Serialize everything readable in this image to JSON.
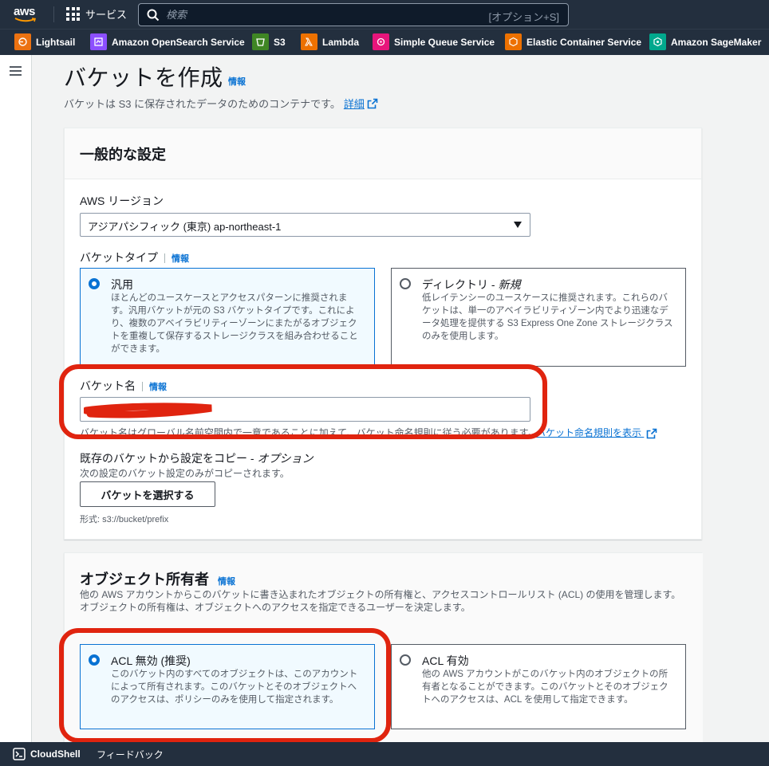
{
  "topbar": {
    "logo": "aws",
    "services_label": "サービス",
    "search_placeholder": "検索",
    "search_shortcut": "[オプション+S]"
  },
  "favorites": [
    {
      "label": "Lightsail",
      "icon": "lightsail-icon",
      "color": "#ec7211"
    },
    {
      "label": "Amazon OpenSearch Service",
      "icon": "opensearch-icon",
      "color": "#8c4fff"
    },
    {
      "label": "S3",
      "icon": "s3-icon",
      "color": "#3f8624"
    },
    {
      "label": "Lambda",
      "icon": "lambda-icon",
      "color": "#ed7100"
    },
    {
      "label": "Simple Queue Service",
      "icon": "sqs-icon",
      "color": "#e7157b"
    },
    {
      "label": "Elastic Container Service",
      "icon": "ecs-icon",
      "color": "#ed7100"
    },
    {
      "label": "Amazon SageMaker",
      "icon": "sagemaker-icon",
      "color": "#01a88d"
    }
  ],
  "page": {
    "title": "バケットを作成",
    "info": "情報",
    "subtitle": "バケットは S3 に保存されたデータのためのコンテナです。",
    "subtitle_link": "詳細"
  },
  "general": {
    "heading": "一般的な設定",
    "region_label": "AWS リージョン",
    "region_value": "アジアパシフィック (東京) ap-northeast-1",
    "bucket_type_label": "バケットタイプ",
    "info": "情報",
    "types": [
      {
        "title": "汎用",
        "selected": true,
        "description": "ほとんどのユースケースとアクセスパターンに推奨されます。汎用バケットが元の S3 バケットタイプです。これにより、複数のアベイラビリティーゾーンにまたがるオブジェクトを重複して保存するストレージクラスを組み合わせることができます。"
      },
      {
        "title": "ディレクトリ - ",
        "title_em": "新規",
        "selected": false,
        "description": "低レイテンシーのユースケースに推奨されます。これらのバケットは、単一のアベイラビリティゾーン内でより迅速なデータ処理を提供する S3 Express One Zone ストレージクラスのみを使用します。"
      }
    ],
    "bucket_name_label": "バケット名",
    "bucket_name_info": "情報",
    "bucket_name_helper": "バケット名はグローバル名前空間内で一意であることに加えて、バケット命名規則に従う必要があります。",
    "rules_link": "バケット命名規則を表示",
    "copy_label": "既存のバケットから設定をコピー - ",
    "copy_label_em": "オプション",
    "copy_desc": "次の設定のバケット設定のみがコピーされます。",
    "choose_button": "バケットを選択する",
    "format_hint": "形式: s3://bucket/prefix"
  },
  "ownership": {
    "heading": "オブジェクト所有者",
    "info": "情報",
    "description": "他の AWS アカウントからこのバケットに書き込まれたオブジェクトの所有権と、アクセスコントロールリスト (ACL) の使用を管理します。オブジェクトの所有権は、オブジェクトへのアクセスを指定できるユーザーを決定します。",
    "options": [
      {
        "title": "ACL 無効 (推奨)",
        "selected": true,
        "description": "このバケット内のすべてのオブジェクトは、このアカウントによって所有されます。このバケットとそのオブジェクトへのアクセスは、ポリシーのみを使用して指定されます。"
      },
      {
        "title": "ACL 有効",
        "selected": false,
        "description": "他の AWS アカウントがこのバケット内のオブジェクトの所有者となることができます。このバケットとそのオブジェクトへのアクセスは、ACL を使用して指定できます。"
      }
    ]
  },
  "footer": {
    "cloudshell": "CloudShell",
    "feedback": "フィードバック"
  },
  "colors": {
    "nav": "#232f3e",
    "link": "#0972d3",
    "annotation": "#e0240f"
  }
}
